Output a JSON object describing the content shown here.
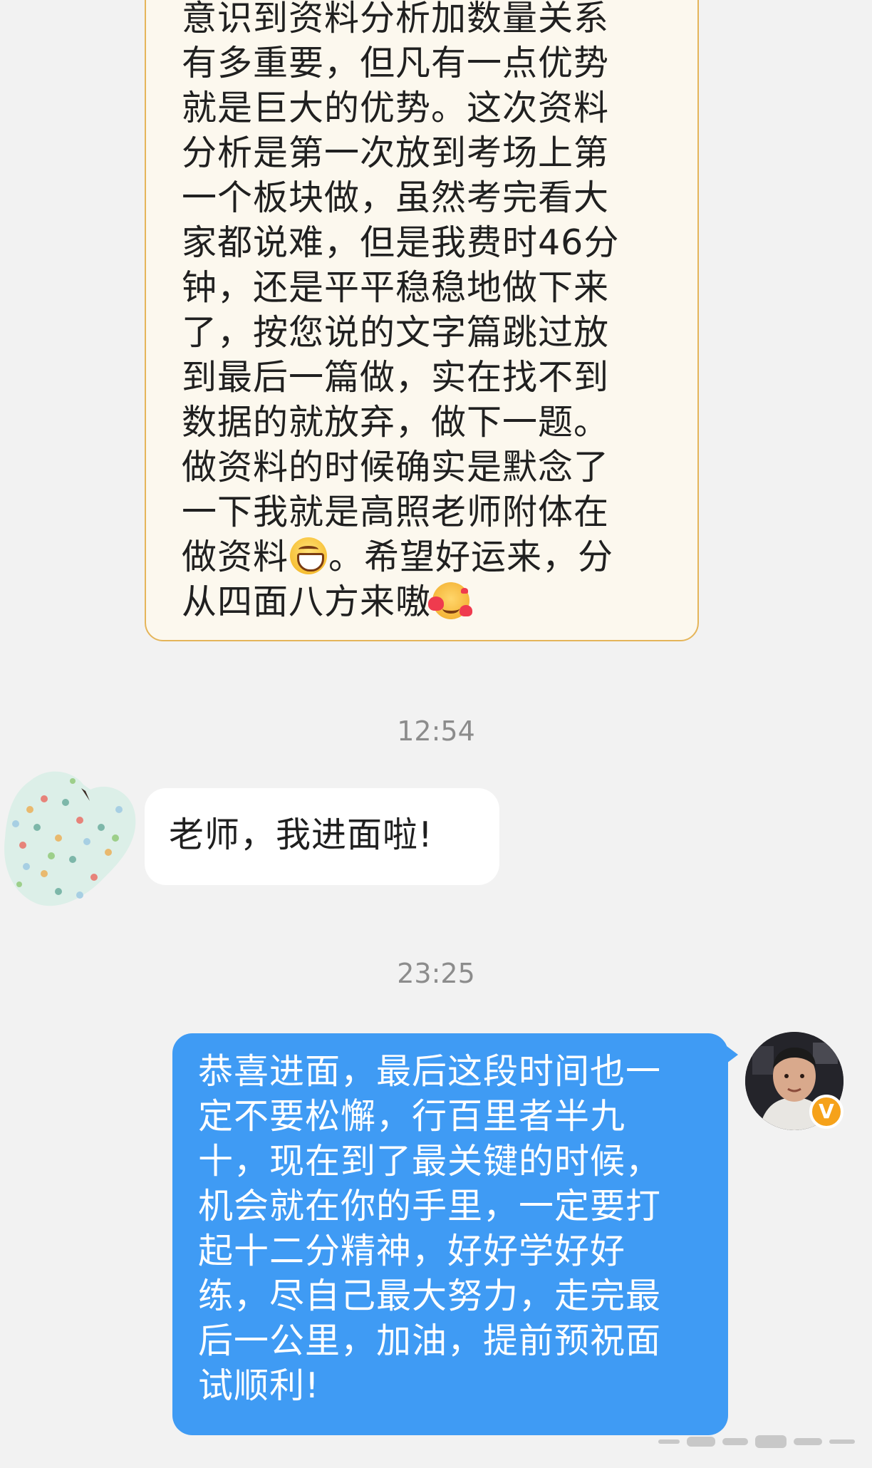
{
  "messages": {
    "top_incoming": {
      "lines": [
        "意识到资料分析加数量关系",
        "有多重要，但凡有一点优势",
        "就是巨大的优势。这次资料",
        "分析是第一次放到考场上第",
        "一个板块做，虽然考完看大",
        "家都说难，但是我费时46分",
        "钟，还是平平稳稳地做下来",
        "了，按您说的文字篇跳过放",
        "到最后一篇做，实在找不到",
        "数据的就放弃，做下一题。",
        "做资料的时候确实是默念了",
        "一下我就是高照老师附体在"
      ],
      "line_with_emoji_1_prefix": "做资料",
      "line_with_emoji_1_suffix": "。希望好运来，分",
      "line_with_emoji_2_prefix": "从四面八方来嗷",
      "emoji_1": "grin-icon",
      "emoji_2": "love-icon"
    },
    "timestamp_1": "12:54",
    "left_message": "老师，我进面啦!",
    "timestamp_2": "23:25",
    "right_message": {
      "lines": [
        "恭喜进面，最后这段时间也一",
        "定不要松懈，行百里者半九",
        "十，现在到了最关键的时候，",
        "机会就在你的手里，一定要打",
        "起十二分精神，好好学好好",
        "练，尽自己最大努力，走完最",
        "后一公里，加油，提前预祝面",
        "试顺利!"
      ]
    },
    "verified_badge": "V"
  },
  "colors": {
    "background": "#f2f2f2",
    "incoming_bubble_tinted": "#fcf8ee",
    "incoming_border": "#e5b55a",
    "incoming_bubble": "#ffffff",
    "outgoing_bubble": "#3f9bf4",
    "timestamp": "#8c8c8c",
    "badge": "#f6a21a"
  }
}
